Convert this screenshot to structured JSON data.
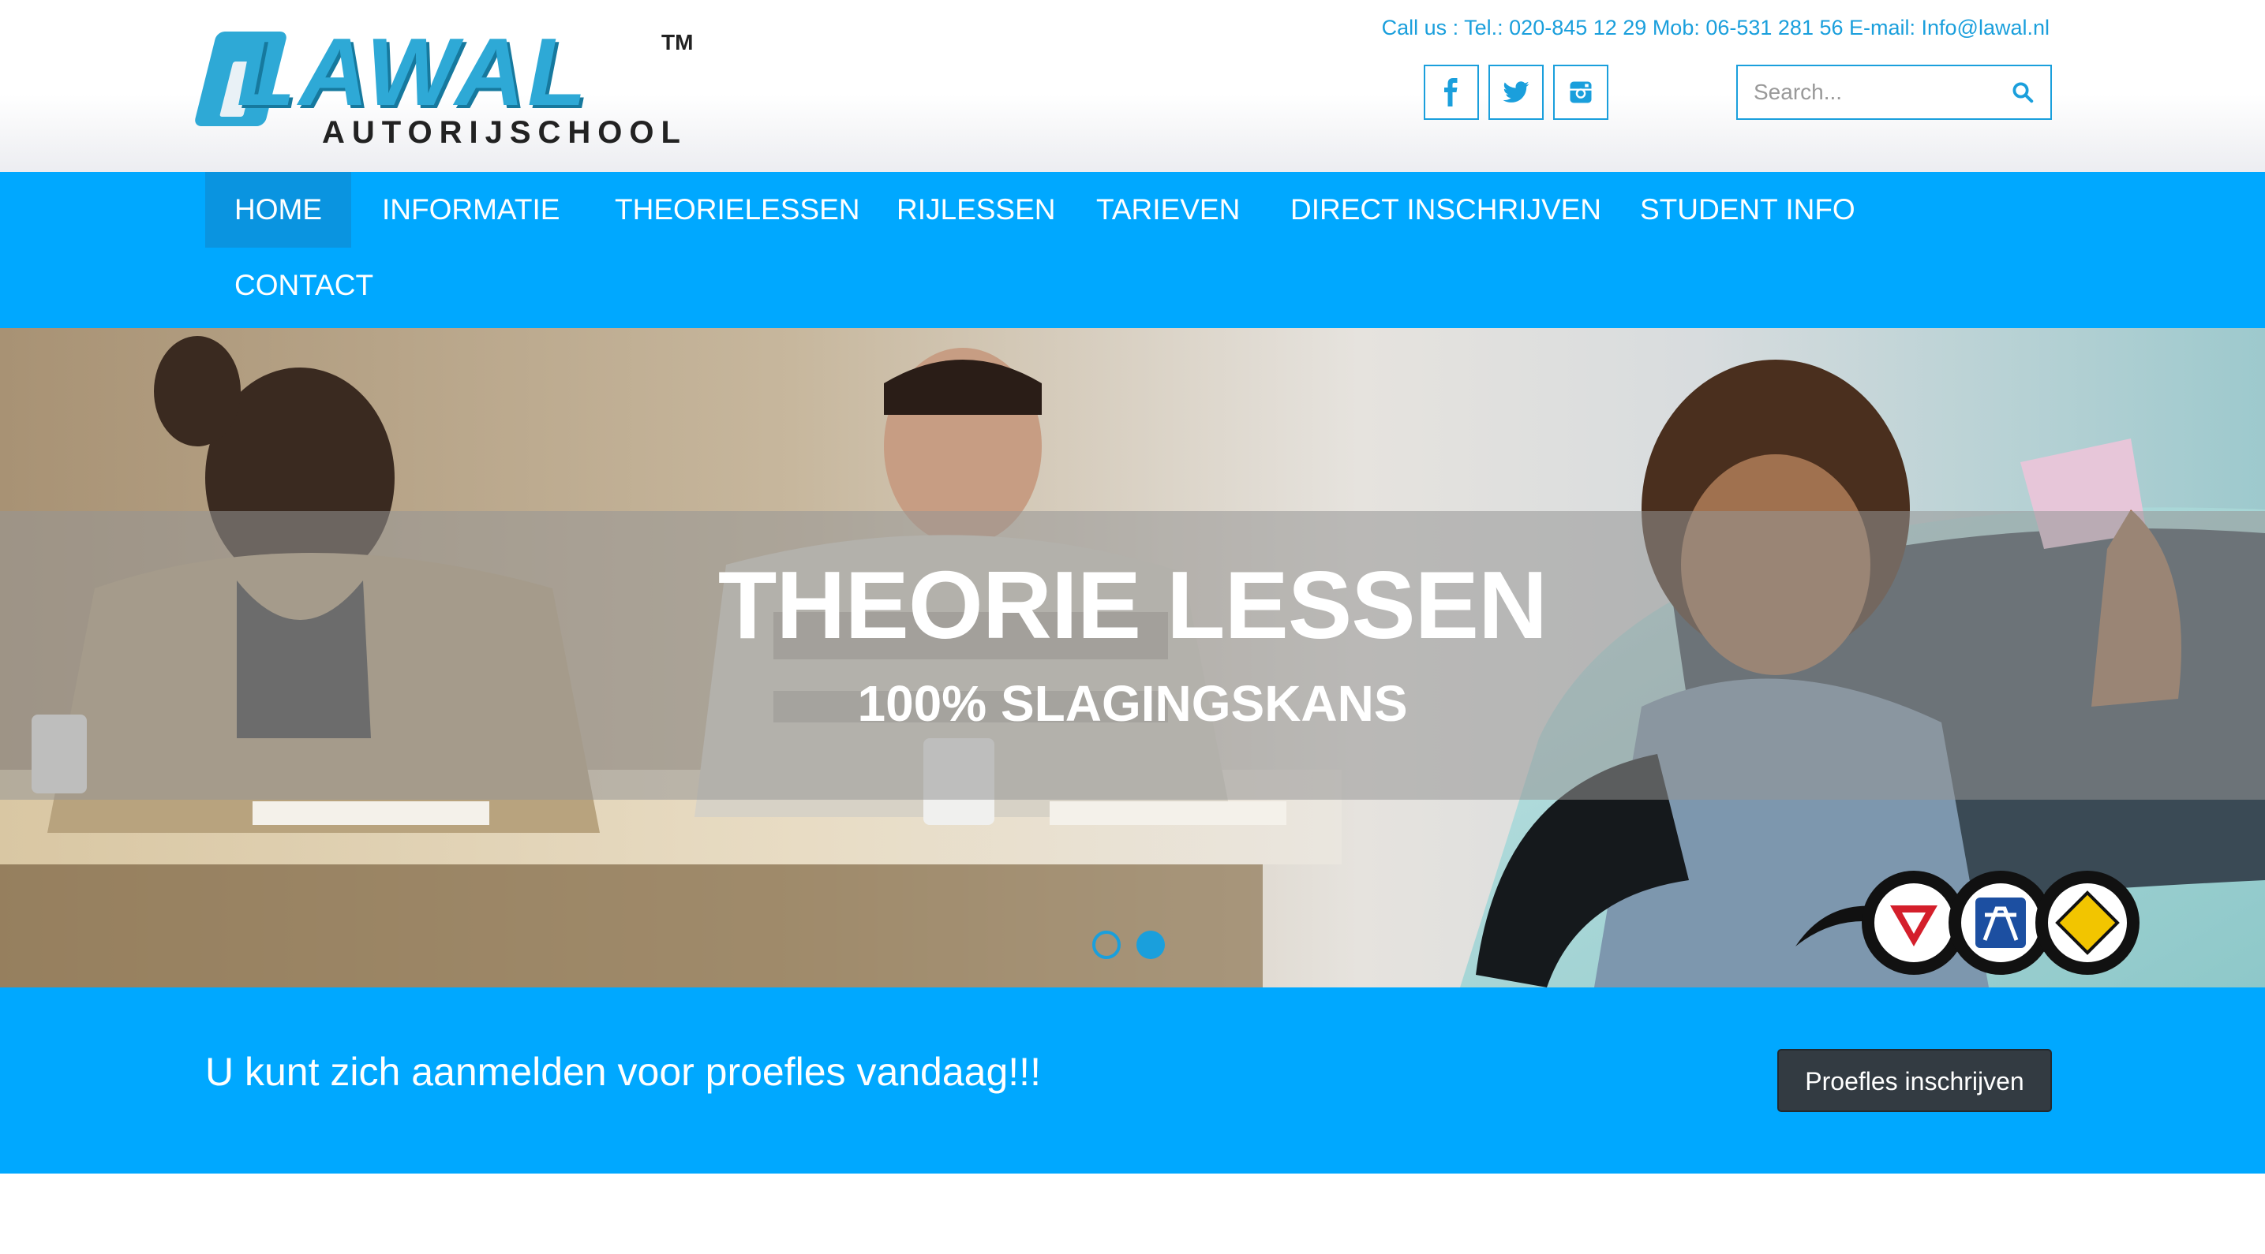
{
  "brand": {
    "logo_main": "LAWAL",
    "logo_tm": "TM",
    "logo_sub": "AUTORIJSCHOOL",
    "accent": "#1a9fdc",
    "nav_bg": "#00a8ff"
  },
  "header": {
    "contact": "Call us : Tel.: 020-845 12 29 Mob: 06-531 281 56 E-mail: Info@lawal.nl",
    "social": [
      {
        "name": "facebook-icon"
      },
      {
        "name": "twitter-icon"
      },
      {
        "name": "instagram-icon"
      }
    ],
    "search": {
      "placeholder": "Search...",
      "value": ""
    }
  },
  "nav": {
    "items": [
      {
        "label": "HOME",
        "active": true
      },
      {
        "label": "INFORMATIE"
      },
      {
        "label": "THEORIELESSEN"
      },
      {
        "label": "RIJLESSEN"
      },
      {
        "label": "TARIEVEN"
      },
      {
        "label": "DIRECT INSCHRIJVEN"
      },
      {
        "label": "STUDENT INFO"
      },
      {
        "label": "CONTACT"
      }
    ]
  },
  "hero": {
    "title": "THEORIE LESSEN",
    "subtitle": "100% SLAGINGSKANS",
    "slides_total": 2,
    "active_slide": 2
  },
  "cta": {
    "text": "U kunt zich aanmelden voor proefles vandaag!!!",
    "button": "Proefles inschrijven"
  }
}
